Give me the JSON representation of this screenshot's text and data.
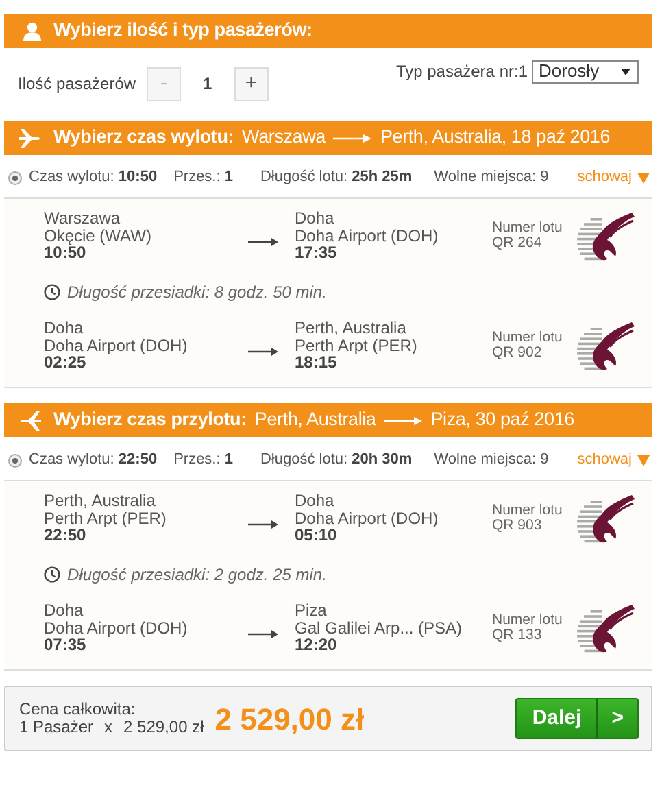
{
  "passengers": {
    "title": "Wybierz ilość i typ pasażerów:",
    "count_label": "Ilość pasażerów",
    "minus": "-",
    "minus_disabled": true,
    "count": "1",
    "plus": "+",
    "type_label": "Typ pasażera nr:1",
    "type_value": "Dorosły"
  },
  "journeys": [
    {
      "kind": "outbound",
      "title": "Wybierz czas wylotu:",
      "from": "Warszawa",
      "to": "Perth, Australia, 18 paź 2016",
      "options": [
        {
          "selected": true,
          "summary": [
            "Czas wylotu: **10:50**",
            "Przes.: **1**",
            "Długość lotu: **25h 25m**",
            "Wolne miejsca: 9"
          ],
          "toggle": "schowaj",
          "expanded": true,
          "segments": [
            {
              "kind": "leg",
              "from_city": "Warszawa",
              "from_airport": "Okęcie (WAW)",
              "dep_time": "10:50",
              "to_city": "Doha",
              "to_airport": "Doha Airport (DOH)",
              "arr_time": "17:35",
              "flight_label": "Numer lotu",
              "flight_no": "QR 264"
            },
            {
              "kind": "layover",
              "text": "Długość przesiadki: 8 godz. 50 min."
            },
            {
              "kind": "leg",
              "from_city": "Doha",
              "from_airport": "Doha Airport (DOH)",
              "dep_time": "02:25",
              "to_city": "Perth, Australia",
              "to_airport": "Perth Arpt (PER)",
              "arr_time": "18:15",
              "flight_label": "Numer lotu",
              "flight_no": "QR 902"
            }
          ]
        }
      ]
    },
    {
      "kind": "return",
      "title": "Wybierz czas przylotu:",
      "from": "Perth, Australia",
      "to": "Piza, 30 paź 2016",
      "options": [
        {
          "selected": true,
          "summary": [
            "Czas wylotu: **22:50**",
            "Przes.: **1**",
            "Długość lotu: **20h 30m**",
            "Wolne miejsca: 9"
          ],
          "toggle": "schowaj",
          "expanded": true,
          "segments": [
            {
              "kind": "leg",
              "from_city": "Perth, Australia",
              "from_airport": "Perth Arpt (PER)",
              "dep_time": "22:50",
              "to_city": "Doha",
              "to_airport": "Doha Airport (DOH)",
              "arr_time": "05:10",
              "flight_label": "Numer lotu",
              "flight_no": "QR 903"
            },
            {
              "kind": "layover",
              "text": "Długość przesiadki: 2 godz. 25 min."
            },
            {
              "kind": "leg",
              "from_city": "Doha",
              "from_airport": "Doha Airport (DOH)",
              "dep_time": "07:35",
              "to_city": "Piza",
              "to_airport": "Gal Galilei Arp... (PSA)",
              "arr_time": "12:20",
              "flight_label": "Numer lotu",
              "flight_no": "QR 133"
            }
          ]
        }
      ]
    }
  ],
  "footer": {
    "total_label": "Cena całkowita:",
    "passengers": "1 Pasażer",
    "times": "x",
    "unit_price": "2 529,00 zł",
    "total": "2 529,00 zł",
    "button": "Dalej",
    "button_arrow": ">"
  }
}
